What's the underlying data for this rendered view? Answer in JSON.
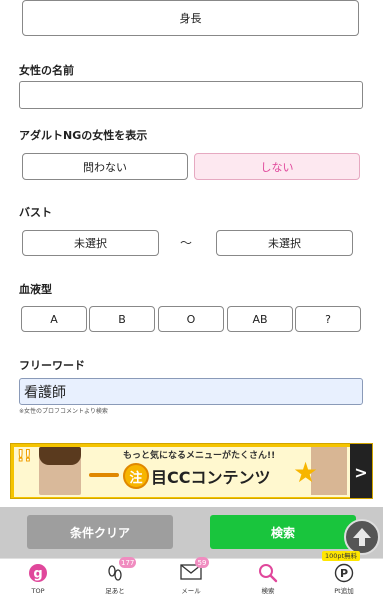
{
  "colors": {
    "accent_pink": "#e0479b",
    "search_green": "#19c53d",
    "clear_gray": "#9e9e9e",
    "badge_pink": "#f08cc0"
  },
  "height_button": {
    "label": "身長"
  },
  "name_section": {
    "label": "女性の名前",
    "value": ""
  },
  "adult_section": {
    "label": "アダルトNGの女性を表示",
    "options": [
      "問わない",
      "しない"
    ],
    "selected": "しない"
  },
  "bust_section": {
    "label": "バスト",
    "min": "未選択",
    "separator": "〜",
    "max": "未選択"
  },
  "blood_section": {
    "label": "血液型",
    "options": [
      "A",
      "B",
      "O",
      "AB",
      "?"
    ]
  },
  "free_word_section": {
    "label": "フリーワード",
    "value": "看護師",
    "note": "※女性のプロフコメントより検索"
  },
  "banner": {
    "exclaim": "!!",
    "subtitle": "もっと気になるメニューがたくさん!!",
    "badge": "注",
    "title": "目CCコンテンツ",
    "arrow": ">"
  },
  "actions": {
    "clear_label": "条件クリア",
    "search_label": "検索"
  },
  "tabs": [
    {
      "label": "TOP",
      "icon": "g-logo-icon"
    },
    {
      "label": "足あと",
      "icon": "footprints-icon",
      "badge": "177"
    },
    {
      "label": "メール",
      "icon": "mail-icon",
      "badge": "59"
    },
    {
      "label": "検索",
      "icon": "search-icon"
    },
    {
      "label": "Pt追加",
      "icon": "points-icon"
    }
  ],
  "pt_free_badge": "100pt無料"
}
